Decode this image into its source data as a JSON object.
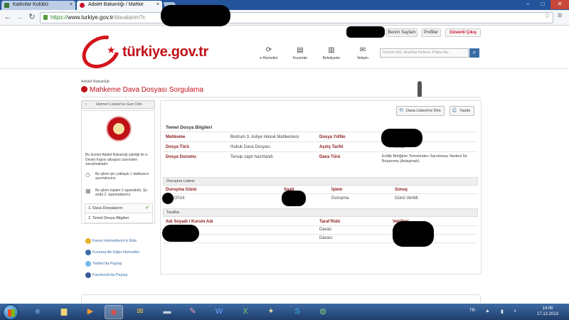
{
  "browser": {
    "tabs": [
      {
        "title": "Kadınlar Kulübü"
      },
      {
        "title": "Adalet Bakanlığı / Mahke"
      }
    ],
    "tab_close": "×",
    "address": {
      "scheme": "https://",
      "host": "www.turkiye.gov.tr",
      "path": "/davalarim?c"
    },
    "controls": {
      "back": "←",
      "forward": "→",
      "reload": "↻",
      "star": "☆",
      "menu": "≡",
      "minimize": "–",
      "maximize": "□",
      "close": "✕"
    }
  },
  "site": {
    "logo_text": "türkiye.gov.tr",
    "util_links": {
      "my_page": "Benim Sayfam",
      "profiles": "Profiller",
      "logout": "Güvenli Çıkış"
    },
    "nav": [
      {
        "label": "e-Hizmetler",
        "icon": "refresh-icon"
      },
      {
        "label": "Kurumlar",
        "icon": "institution-icon"
      },
      {
        "label": "Belediyeler",
        "icon": "municipality-icon"
      },
      {
        "label": "İletişim",
        "icon": "contact-icon"
      }
    ],
    "search_placeholder": "Hizmet Adı, Anahtar Kelime, Plaka No ..."
  },
  "page": {
    "breadcrumb": "Adalet Bakanlığı",
    "title": "Mahkeme Dava Dosyası Sorgulama"
  },
  "left": {
    "back_label": "Hizmet Listesi'ne Geri Dön",
    "description": "Bu hizmet Adalet Bakanlığı işbirliği ile e-Devlet Kapısı altyapısı üzerinden sunulmaktadır.",
    "info": [
      "Bu işlem için yaklaşık 1 dakikanızı ayırmalısınız.",
      "Bu işlem toplam 2 aşamalıdır, Şu anda 2. aşamadasınız."
    ],
    "steps": [
      "1. Dava Dosyalarım",
      "2. Temel Dosya Bilgileri"
    ],
    "share": [
      "Favori Hizmetlerim'e Ekle",
      "Kuruma Ait Diğer Hizmetler",
      "Twitter'da Paylaş",
      "Facebook'da Paylaş"
    ]
  },
  "main": {
    "buttons": {
      "case_list": "Dava Listesi'ne Dön",
      "print": "Yazdır"
    },
    "basic_info": {
      "title": "Temel Dosya Bilgileri",
      "court_label": "Mahkeme",
      "court_value": "Bodrum 3. Asliye Hukuk Mahkemesi",
      "file_type_label": "Dosya Türü",
      "file_type_value": "Hukuk Dava Dosyası",
      "status_label": "Dosya Durumu",
      "status_value": "Tensip zaptı hazırlandı",
      "year_no_label": "Dosya Yıl/No",
      "opening_date_label": "Açılış Tarihi",
      "opening_date_value": "/7/2013",
      "case_type_label": "Dava Türü",
      "case_type_value": "Evlilik Birliğinin Temelinden Sarsılması Nedeni İle Boşanma (Anlaşmalı)"
    },
    "hearings": {
      "title": "Duruşma Listesi",
      "columns": [
        "Duruşma Günü",
        "Saati",
        "İşlem",
        "Sonuç"
      ],
      "rows": [
        {
          "date": "2/2014",
          "time": "",
          "action": "Duruşma",
          "result": "Günü Verildi"
        }
      ]
    },
    "parties": {
      "title": "Taraflar",
      "columns": [
        "Adı Soyadı / Kurum Adı",
        "Taraf Rolü",
        "Vekilleri"
      ],
      "rows": [
        {
          "name": "",
          "role": "Davalı",
          "attorney": ""
        },
        {
          "name": "",
          "role": "Davacı",
          "attorney": ""
        }
      ]
    }
  },
  "taskbar": {
    "language": "TR",
    "time": "14:06",
    "date": "17.12.2013",
    "apps": [
      "explorer-icon",
      "ie-icon",
      "folder-icon",
      "media-icon",
      "chrome-icon",
      "mail-icon",
      "scanner-icon",
      "paint-icon",
      "word-icon",
      "excel-icon",
      "tools-icon",
      "skype-icon",
      "globe-icon"
    ]
  }
}
